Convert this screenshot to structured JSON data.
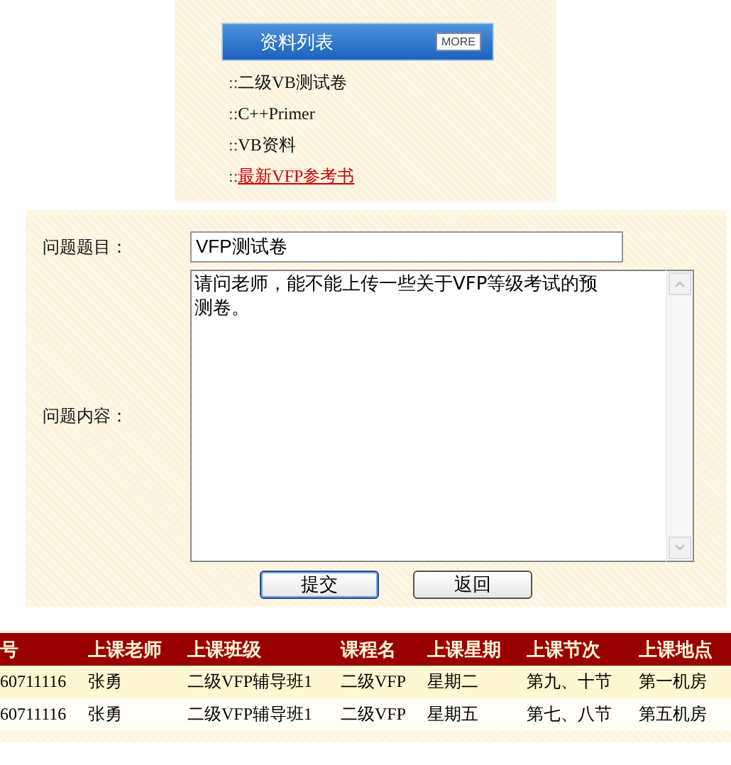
{
  "resource_list": {
    "title": "资料列表",
    "more_button": "MORE",
    "items": [
      {
        "prefix": "::",
        "label": "二级VB测试卷",
        "active": false
      },
      {
        "prefix": "::",
        "label": "C++Primer",
        "active": false
      },
      {
        "prefix": "::",
        "label": "VB资料",
        "active": false
      },
      {
        "prefix": "::",
        "label": "最新VFP参考书",
        "active": true
      }
    ]
  },
  "question_form": {
    "title_label": "问题题目：",
    "title_value": "VFP测试卷",
    "content_label": "问题内容：",
    "content_value": "请问老师，能不能上传一些关于VFP等级考试的预测卷。",
    "buttons": [
      {
        "label": "提交",
        "focused": true
      },
      {
        "label": "返回",
        "focused": false
      }
    ]
  },
  "table": {
    "columns": [
      "号",
      "上课老师",
      "上课班级",
      "课程名",
      "上课星期",
      "上课节次",
      "上课地点"
    ],
    "rows": [
      [
        "60711116",
        "张勇",
        "二级VFP辅导班1",
        "二级VFP",
        "星期二",
        "第九、十节",
        "第一机房"
      ],
      [
        "60711116",
        "张勇",
        "二级VFP辅导班1",
        "二级VFP",
        "星期五",
        "第七、八节",
        "第五机房"
      ]
    ]
  }
}
